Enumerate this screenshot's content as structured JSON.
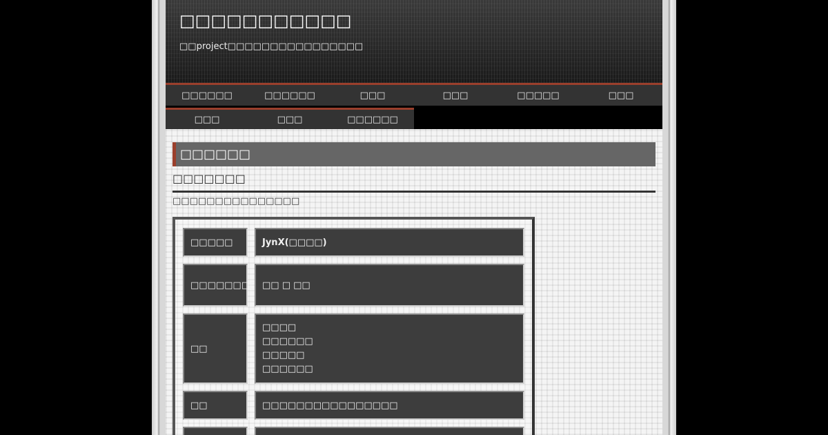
{
  "site": {
    "title": "□□□□□□□□□□□",
    "description": "□□project□□□□□□□□□□□□□□□□"
  },
  "nav": {
    "row1": [
      "□□□□□□",
      "□□□□□□",
      "□□□",
      "□□□",
      "□□□□□",
      "□□□"
    ],
    "row2": [
      "□□□",
      "□□□",
      "□□□□□□"
    ]
  },
  "main": {
    "page_title": "□□□□□□",
    "section_heading": "□□□□□□□",
    "intro": "□□□□□□□□□□□□□□□",
    "rows": [
      {
        "key": "□□□□□",
        "value": "JynX(□□□□)"
      },
      {
        "key": "□□□□□□□□",
        "value": "□□ □ □□"
      },
      {
        "key": "□□",
        "lines": [
          "□□□□",
          "□□□□□□",
          "□□□□□",
          "□□□□□□"
        ]
      },
      {
        "key": "□□",
        "value": "□□□□□□□□□□□□□□□□"
      },
      {
        "key": "",
        "value": ""
      }
    ]
  },
  "colors": {
    "accent": "#9b3f2c",
    "nav_bg": "#333333",
    "cell_bg": "#3d3d3d"
  }
}
